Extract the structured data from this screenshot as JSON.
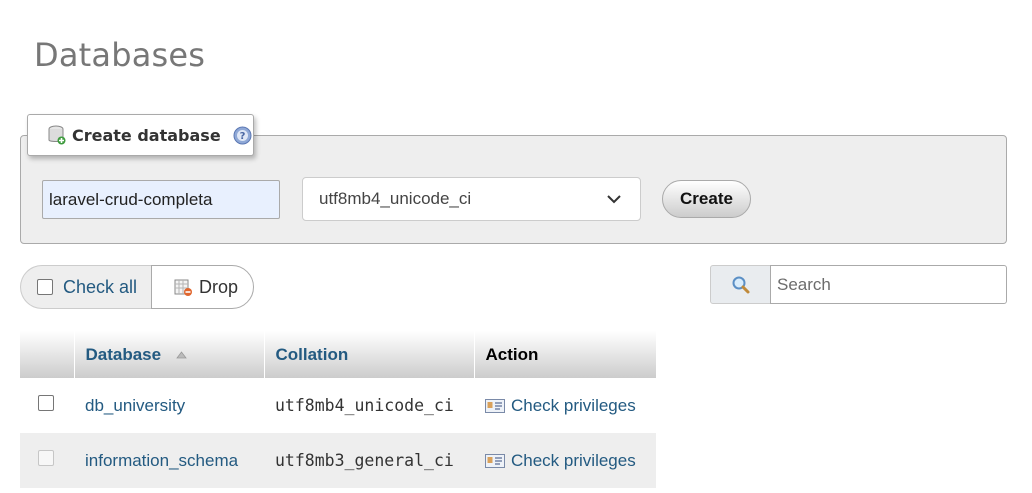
{
  "page": {
    "title": "Databases"
  },
  "create_database": {
    "legend_label": "Create database",
    "name_value": "laravel-crud-completa",
    "collation_selected": "utf8mb4_unicode_ci",
    "create_label": "Create"
  },
  "toolbar": {
    "check_all_label": "Check all",
    "drop_label": "Drop",
    "search_placeholder": "Search"
  },
  "table": {
    "columns": [
      "Database",
      "Collation",
      "Action"
    ],
    "sorted_by": "Database",
    "rows": [
      {
        "database": "db_university",
        "collation": "utf8mb4_unicode_ci",
        "action": "Check privileges"
      },
      {
        "database": "information_schema",
        "collation": "utf8mb3_general_ci",
        "action": "Check privileges"
      }
    ]
  },
  "colors": {
    "link": "#235a81",
    "panel": "#eeeeee",
    "title": "#777777"
  },
  "icons": [
    "database-add-icon",
    "help-icon",
    "chevron-down-icon",
    "drop-icon",
    "search-icon",
    "sort-asc-icon",
    "privileges-icon"
  ]
}
